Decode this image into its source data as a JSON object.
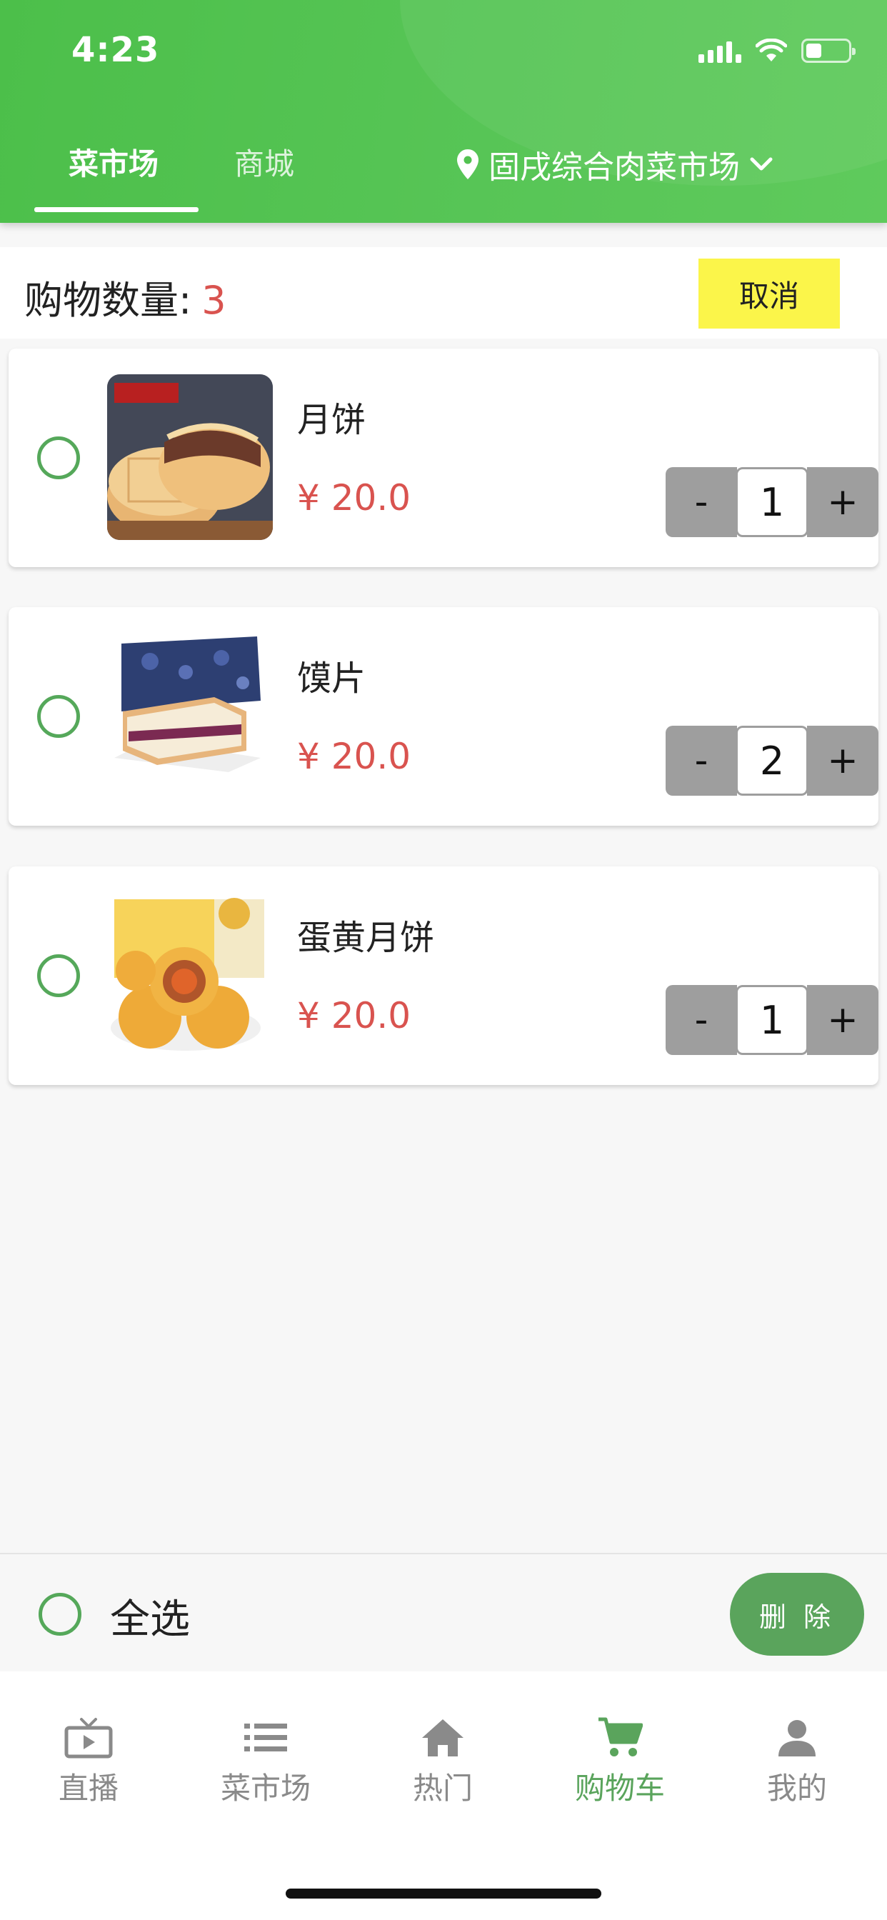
{
  "status_bar": {
    "time": "4:23"
  },
  "header": {
    "tabs": [
      {
        "label": "菜市场",
        "active": true
      },
      {
        "label": "商城",
        "active": false
      }
    ],
    "location": "固戌综合肉菜市场"
  },
  "cart": {
    "count_label": "购物数量:",
    "count": "3",
    "cancel_label": "取消",
    "items": [
      {
        "name": "月饼",
        "price": "¥ 20.0",
        "quantity": "1",
        "image": "mooncake-image"
      },
      {
        "name": "馍片",
        "price": "¥ 20.0",
        "quantity": "2",
        "image": "sandwich-bread-image"
      },
      {
        "name": "蛋黄月饼",
        "price": "¥ 20.0",
        "quantity": "1",
        "image": "egg-yolk-mooncake-image"
      }
    ],
    "minus_label": "-",
    "plus_label": "+"
  },
  "select_all": {
    "label": "全选",
    "delete_label": "删 除"
  },
  "bottom_nav": [
    {
      "label": "直播",
      "icon": "tv-icon",
      "active": false
    },
    {
      "label": "菜市场",
      "icon": "list-icon",
      "active": false
    },
    {
      "label": "热门",
      "icon": "home-icon",
      "active": false
    },
    {
      "label": "购物车",
      "icon": "cart-icon",
      "active": true
    },
    {
      "label": "我的",
      "icon": "person-icon",
      "active": false
    }
  ],
  "colors": {
    "header_green": "#4cbf4a",
    "accent_green": "#5aa45c",
    "price_red": "#d9534f",
    "cancel_yellow": "#fbf54a",
    "stepper_gray": "#9e9e9e"
  }
}
